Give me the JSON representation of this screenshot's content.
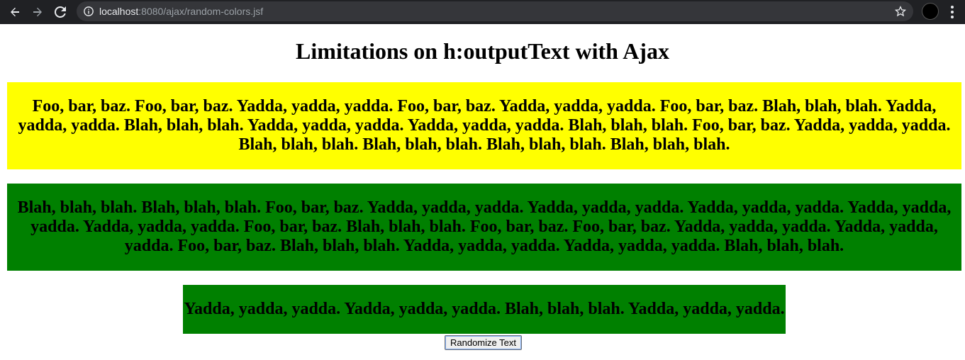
{
  "browser": {
    "url_host": "localhost",
    "url_path": ":8080/ajax/random-colors.jsf",
    "icons": [
      "back-arrow-icon",
      "forward-arrow-icon",
      "reload-icon",
      "info-icon",
      "star-icon",
      "profile-avatar",
      "menu-dots-icon"
    ]
  },
  "page": {
    "title": "Limitations on h:outputText with Ajax",
    "yellow_text": "Foo, bar, baz. Foo, bar, baz. Yadda, yadda, yadda. Foo, bar, baz. Yadda, yadda, yadda. Foo, bar, baz. Blah, blah, blah. Yadda, yadda, yadda. Blah, blah, blah. Yadda, yadda, yadda. Yadda, yadda, yadda. Blah, blah, blah. Foo, bar, baz. Yadda, yadda, yadda. Blah, blah, blah. Blah, blah, blah. Blah, blah, blah. Blah, blah, blah.",
    "green_text": "Blah, blah, blah. Blah, blah, blah. Foo, bar, baz. Yadda, yadda, yadda. Yadda, yadda, yadda. Yadda, yadda, yadda. Yadda, yadda, yadda. Yadda, yadda, yadda. Foo, bar, baz. Blah, blah, blah. Foo, bar, baz. Foo, bar, baz. Yadda, yadda, yadda. Yadda, yadda, yadda. Foo, bar, baz. Blah, blah, blah. Yadda, yadda, yadda. Yadda, yadda, yadda. Blah, blah, blah.",
    "small_green_text": "Yadda, yadda, yadda. Yadda, yadda, yadda. Blah, blah, blah. Yadda, yadda, yadda.",
    "button_label": "Randomize Text"
  },
  "colors": {
    "yellow": "#ffff00",
    "green": "#008000",
    "toolbar": "#202124"
  }
}
